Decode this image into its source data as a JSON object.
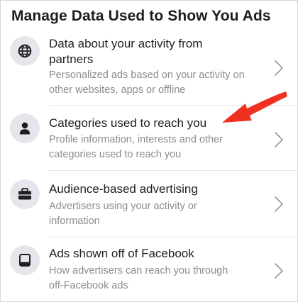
{
  "page": {
    "title": "Manage Data Used to Show You Ads"
  },
  "items": [
    {
      "icon": "globe-icon",
      "title_lines": [
        "Data about your activity from",
        "partners"
      ],
      "desc_lines": [
        "Personalized ads based on your activity on",
        "other websites, apps or offline"
      ]
    },
    {
      "icon": "person-icon",
      "title_lines": [
        "Categories used to reach you"
      ],
      "desc_lines": [
        "Profile information, interests and other",
        "categories used to reach you"
      ]
    },
    {
      "icon": "briefcase-icon",
      "title_lines": [
        "Audience-based advertising"
      ],
      "desc_lines": [
        "Advertisers using your activity or",
        "information"
      ]
    },
    {
      "icon": "laptop-icon",
      "title_lines": [
        "Ads shown off of Facebook"
      ],
      "desc_lines": [
        "How advertisers can reach you through",
        "off-Facebook ads"
      ]
    }
  ],
  "annotation": {
    "arrow_color": "#f0311f",
    "points_to": "Categories used to reach you"
  },
  "colors": {
    "text": "#1c1e21",
    "secondary_text": "#8a8d91",
    "icon_bg": "#e4e6eb",
    "chevron": "#9a9da2"
  }
}
